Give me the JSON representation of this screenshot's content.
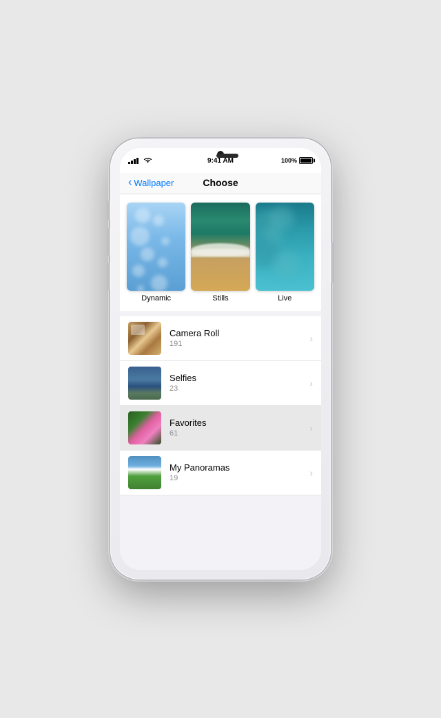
{
  "phone": {
    "status": {
      "time": "9:41 AM",
      "battery_pct": "100%"
    }
  },
  "nav": {
    "back_label": "Wallpaper",
    "title": "Choose"
  },
  "wallpaper_types": [
    {
      "id": "dynamic",
      "label": "Dynamic"
    },
    {
      "id": "stills",
      "label": "Stills"
    },
    {
      "id": "live",
      "label": "Live"
    }
  ],
  "albums": [
    {
      "id": "camera-roll",
      "name": "Camera Roll",
      "count": "191",
      "selected": false
    },
    {
      "id": "selfies",
      "name": "Selfies",
      "count": "23",
      "selected": false
    },
    {
      "id": "favorites",
      "name": "Favorites",
      "count": "61",
      "selected": true
    },
    {
      "id": "my-panoramas",
      "name": "My Panoramas",
      "count": "19",
      "selected": false
    }
  ],
  "icons": {
    "back_chevron": "‹",
    "list_chevron": "›"
  }
}
